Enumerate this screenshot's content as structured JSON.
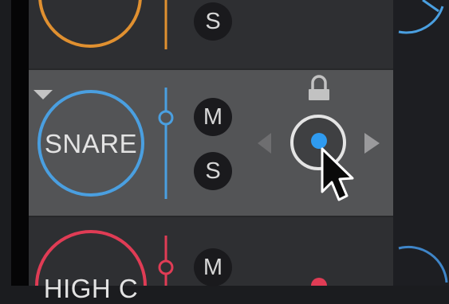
{
  "colors": {
    "orange": "#e09030",
    "blue": "#4a9fe0",
    "red": "#e03c55",
    "knob_dot": "#2f9bf0",
    "selected_row_bg": "#535456"
  },
  "tracks": [
    {
      "id": "top",
      "name": "",
      "color": "orange",
      "solo_label": "S"
    },
    {
      "id": "selected",
      "name": "SNARE",
      "color": "blue",
      "mute_label": "M",
      "solo_label": "S",
      "icons": [
        "dropdown-triangle-icon",
        "lock-icon",
        "arrow-left-icon",
        "arrow-right-icon"
      ]
    },
    {
      "id": "bottom",
      "name": "HIGH C",
      "color": "red",
      "mute_label": "M"
    }
  ],
  "cursor": "arrow-pointer-icon"
}
